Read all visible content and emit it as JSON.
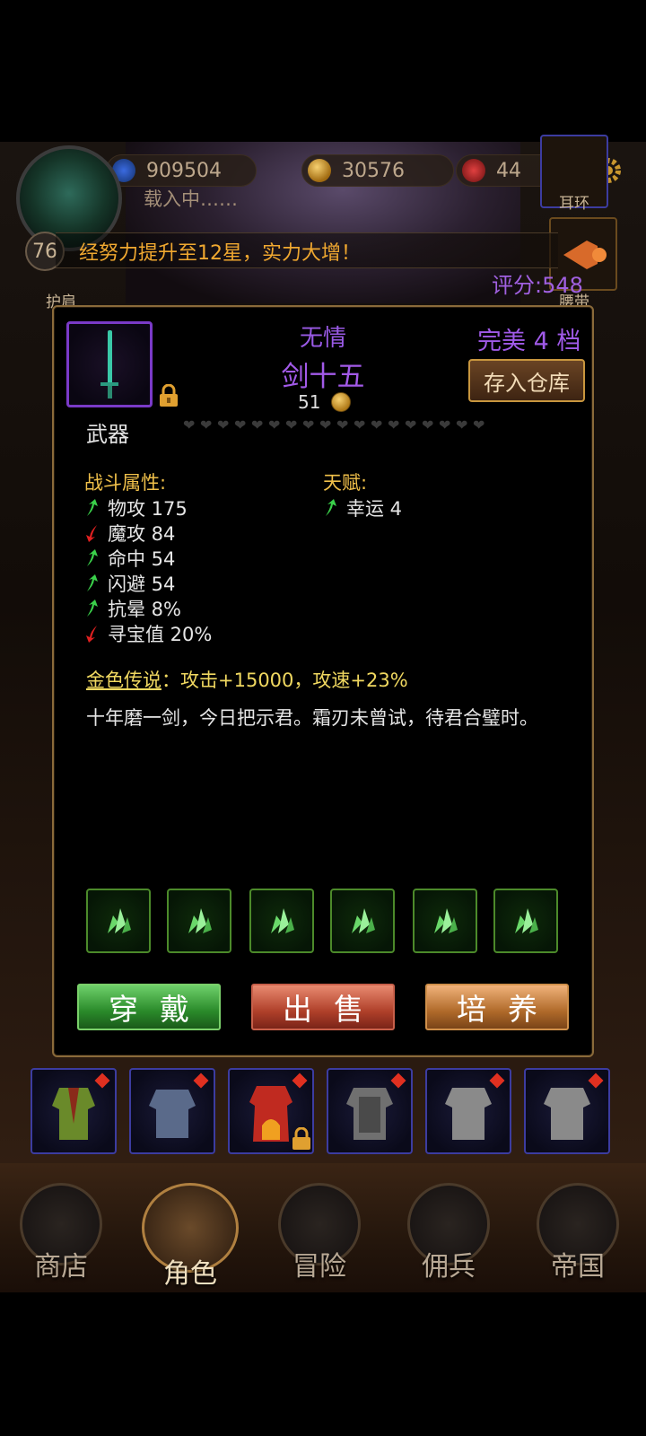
{
  "resources": {
    "diamonds": "909504",
    "gold": "30576",
    "rubies": "44"
  },
  "player": {
    "level": "76",
    "loading_text": "载入中……",
    "score": "评分:548"
  },
  "notice": "经努力提升至12星，实力大增！",
  "side_slots": {
    "earring": "耳环",
    "shoulder": "护肩",
    "belt": "腰带"
  },
  "item": {
    "quality": "无情",
    "name": "剑十五",
    "price": "51",
    "rank": "完美 4 档",
    "type": "武器",
    "hearts_total": 18,
    "store_button": "存入仓库",
    "combat_title": "战斗属性:",
    "combat_stats": [
      {
        "label": "物攻 175",
        "trend": "up"
      },
      {
        "label": "魔攻 84",
        "trend": "down"
      },
      {
        "label": "命中 54",
        "trend": "up"
      },
      {
        "label": "闪避 54",
        "trend": "up"
      },
      {
        "label": "抗晕 8%",
        "trend": "up"
      },
      {
        "label": "寻宝值 20%",
        "trend": "down"
      }
    ],
    "talent_title": "天赋:",
    "talent_stats": [
      {
        "label": "幸运 4",
        "trend": "up"
      }
    ],
    "legend_name": "金色传说",
    "legend_effect": "：攻击+15000，攻速+23%",
    "flavor": "十年磨一剑，今日把示君。霜刃未曾试，待君合璧时。",
    "gem_count": 6
  },
  "actions": {
    "wear": "穿戴",
    "sell": "出售",
    "train": "培养"
  },
  "nav": [
    {
      "label": "商店",
      "icon": "shop-icon"
    },
    {
      "label": "角色",
      "icon": "hero-icon"
    },
    {
      "label": "冒险",
      "icon": "crossed-swords-icon"
    },
    {
      "label": "佣兵",
      "icon": "mercenary-icon"
    },
    {
      "label": "帝国",
      "icon": "crown-icon"
    }
  ],
  "colors": {
    "epic_purple": "#a25ae8",
    "gold_text": "#f0c04a",
    "stat_up": "#3ad04a",
    "stat_down": "#e02020"
  }
}
